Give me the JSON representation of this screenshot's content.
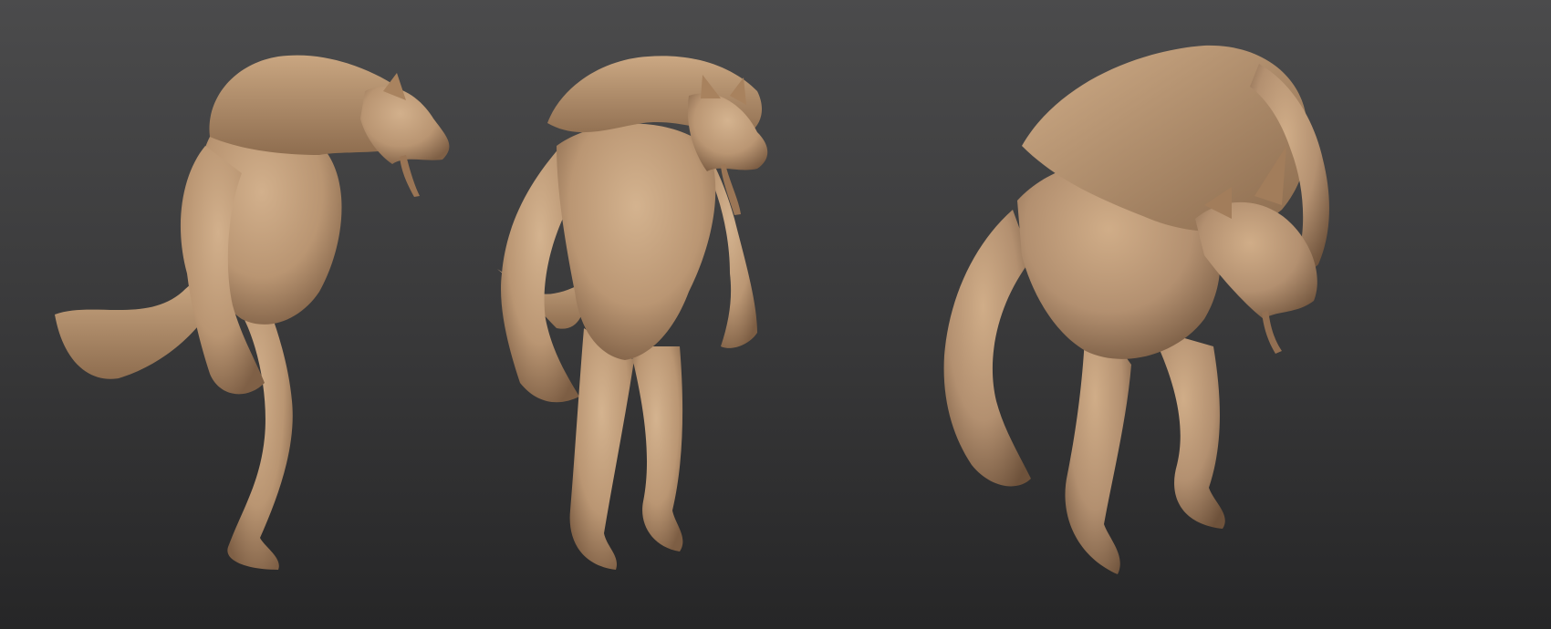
{
  "scene": {
    "background_top": "#4b4b4c",
    "background_bottom": "#262627",
    "material_color": "#b99572",
    "material_shadow": "#8a6a4d",
    "material_highlight": "#d2b08c"
  },
  "figures": [
    {
      "view": "side",
      "icon": "werewolf-side-view-icon"
    },
    {
      "view": "front",
      "icon": "werewolf-front-view-icon"
    },
    {
      "view": "perspective",
      "icon": "werewolf-perspective-view-icon"
    }
  ]
}
